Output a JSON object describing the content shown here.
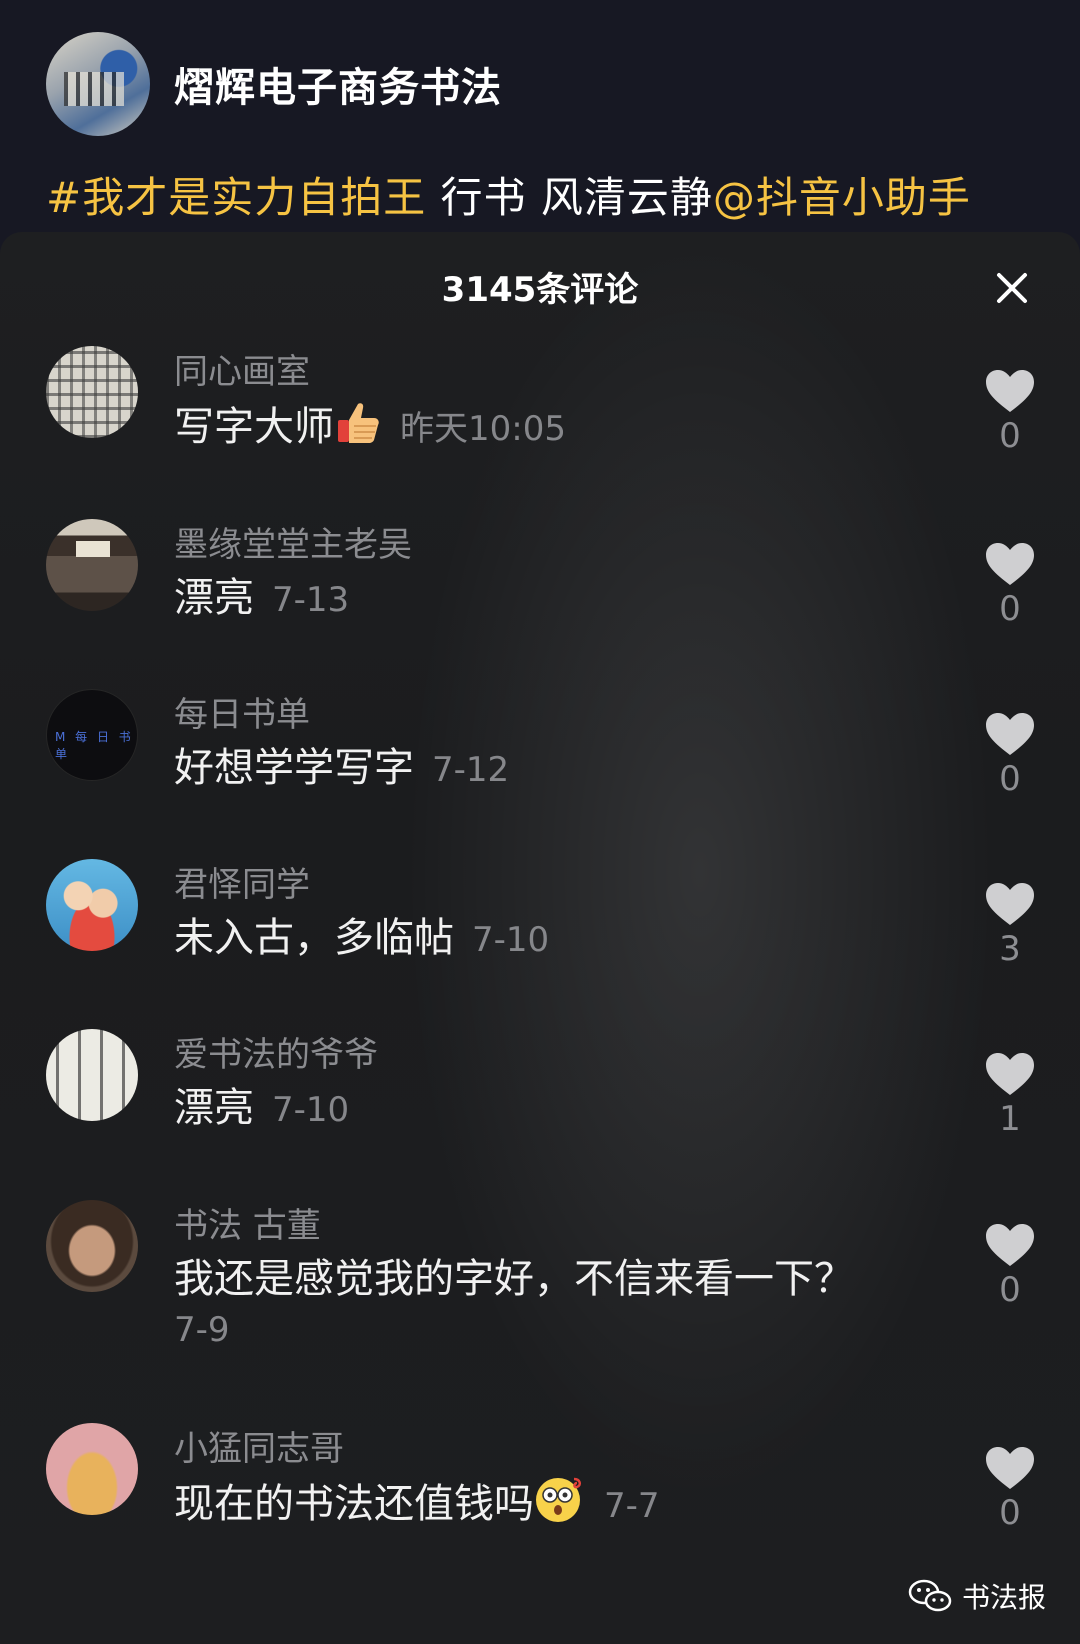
{
  "video": {
    "author_name": "熠辉电子商务书法",
    "caption_tag": "#我才是实力自拍王",
    "caption_text": " 行书   风清云静",
    "caption_mention": "@抖音小助手"
  },
  "comments_panel": {
    "count_label": "3145条评论",
    "close_icon": "close-icon"
  },
  "comments": [
    {
      "user": "同心画室",
      "text": "写字大师",
      "emoji": "thumbs-up-icon",
      "time": "昨天10:05",
      "likes": "0"
    },
    {
      "user": "墨缘堂堂主老吴",
      "text": "漂亮",
      "time": "7-13",
      "likes": "0"
    },
    {
      "user": "每日书单",
      "text": "好想学学写字",
      "time": "7-12",
      "likes": "0"
    },
    {
      "user": "君怿同学",
      "text": "未入古，多临帖",
      "time": "7-10",
      "likes": "3"
    },
    {
      "user": "爱书法的爷爷",
      "text": "漂亮",
      "time": "7-10",
      "likes": "1"
    },
    {
      "user": "书法 古董",
      "text": "我还是感觉我的字好，不信来看一下？",
      "time": "7-9",
      "likes": "0"
    },
    {
      "user": "小猛同志哥",
      "text": "现在的书法还值钱吗",
      "emoji": "dizzy-face-icon",
      "time": "7-7",
      "likes": "0"
    }
  ],
  "watermark": {
    "label": "书法报",
    "icon": "wechat-icon"
  },
  "colors": {
    "tag_yellow": "#f6c343",
    "secondary_gray": "#8b8c90",
    "heart_gray": "#cfcfd1"
  }
}
